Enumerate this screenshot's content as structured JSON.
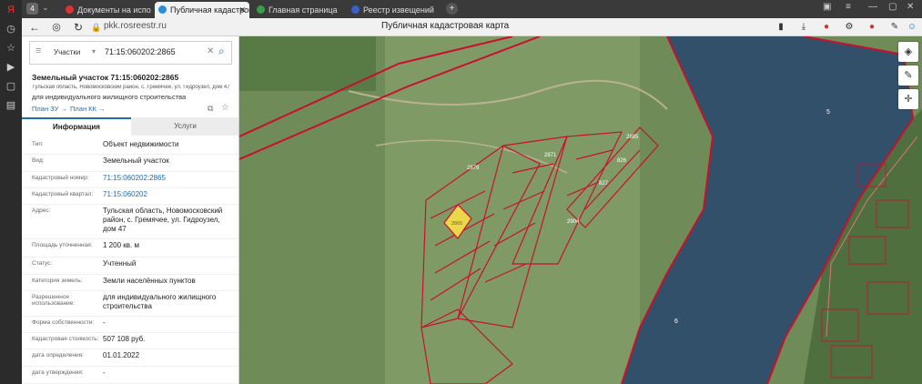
{
  "browser": {
    "tab_counter": "4",
    "tabs": [
      {
        "label": "Документы на исполнение"
      },
      {
        "label": "Публичная кадастровая"
      },
      {
        "label": "Главная страница"
      },
      {
        "label": "Реестр извещений"
      }
    ],
    "url": "pkk.rosreestr.ru",
    "page_title": "Публичная кадастровая карта"
  },
  "search": {
    "category": "Участки",
    "query": "71:15:060202:2865"
  },
  "parcel": {
    "title": "Земельный участок 71:15:060202:2865",
    "address_line": "Тульская область, Новомосковский район, с. Гремячее, ул. Гидроузел, дом 47",
    "purpose_line": "для индивидуального жилищного строительства",
    "plan_zu": "План ЗУ →",
    "plan_kk": "План КК →"
  },
  "tabs": {
    "info": "Информация",
    "services": "Услуги"
  },
  "info": [
    {
      "label": "Тип:",
      "value": "Объект недвижимости"
    },
    {
      "label": "Вид:",
      "value": "Земельный участок"
    },
    {
      "label": "Кадастровый номер:",
      "value": "71:15:060202:2865"
    },
    {
      "label": "Кадастровый квартал:",
      "value": "71:15:060202"
    },
    {
      "label": "Адрес:",
      "value": "Тульская область, Новомосковский район, с. Гремячее, ул. Гидроузел, дом 47"
    },
    {
      "label": "Площадь уточненная:",
      "value": "1 200 кв. м"
    },
    {
      "label": "Статус:",
      "value": "Учтенный"
    },
    {
      "label": "Категория земель:",
      "value": "Земли населённых пунктов"
    },
    {
      "label": "Разрешенное использование:",
      "value": "для индивидуального жилищного строительства"
    },
    {
      "label": "Форма собственности:",
      "value": "-"
    },
    {
      "label": "Кадастровая стоимость:",
      "value": "507 108 руб."
    },
    {
      "label": "дата определения:",
      "value": "01.01.2022"
    },
    {
      "label": "дата утверждения:",
      "value": "-"
    }
  ],
  "map": {
    "labels": [
      "2879",
      "2871",
      "2885",
      "2904",
      "826",
      "827",
      "2865",
      "5",
      "6"
    ],
    "colors": {
      "boundary": "#c8102e",
      "selected": "#e8d84a",
      "water": "#33506b"
    }
  }
}
